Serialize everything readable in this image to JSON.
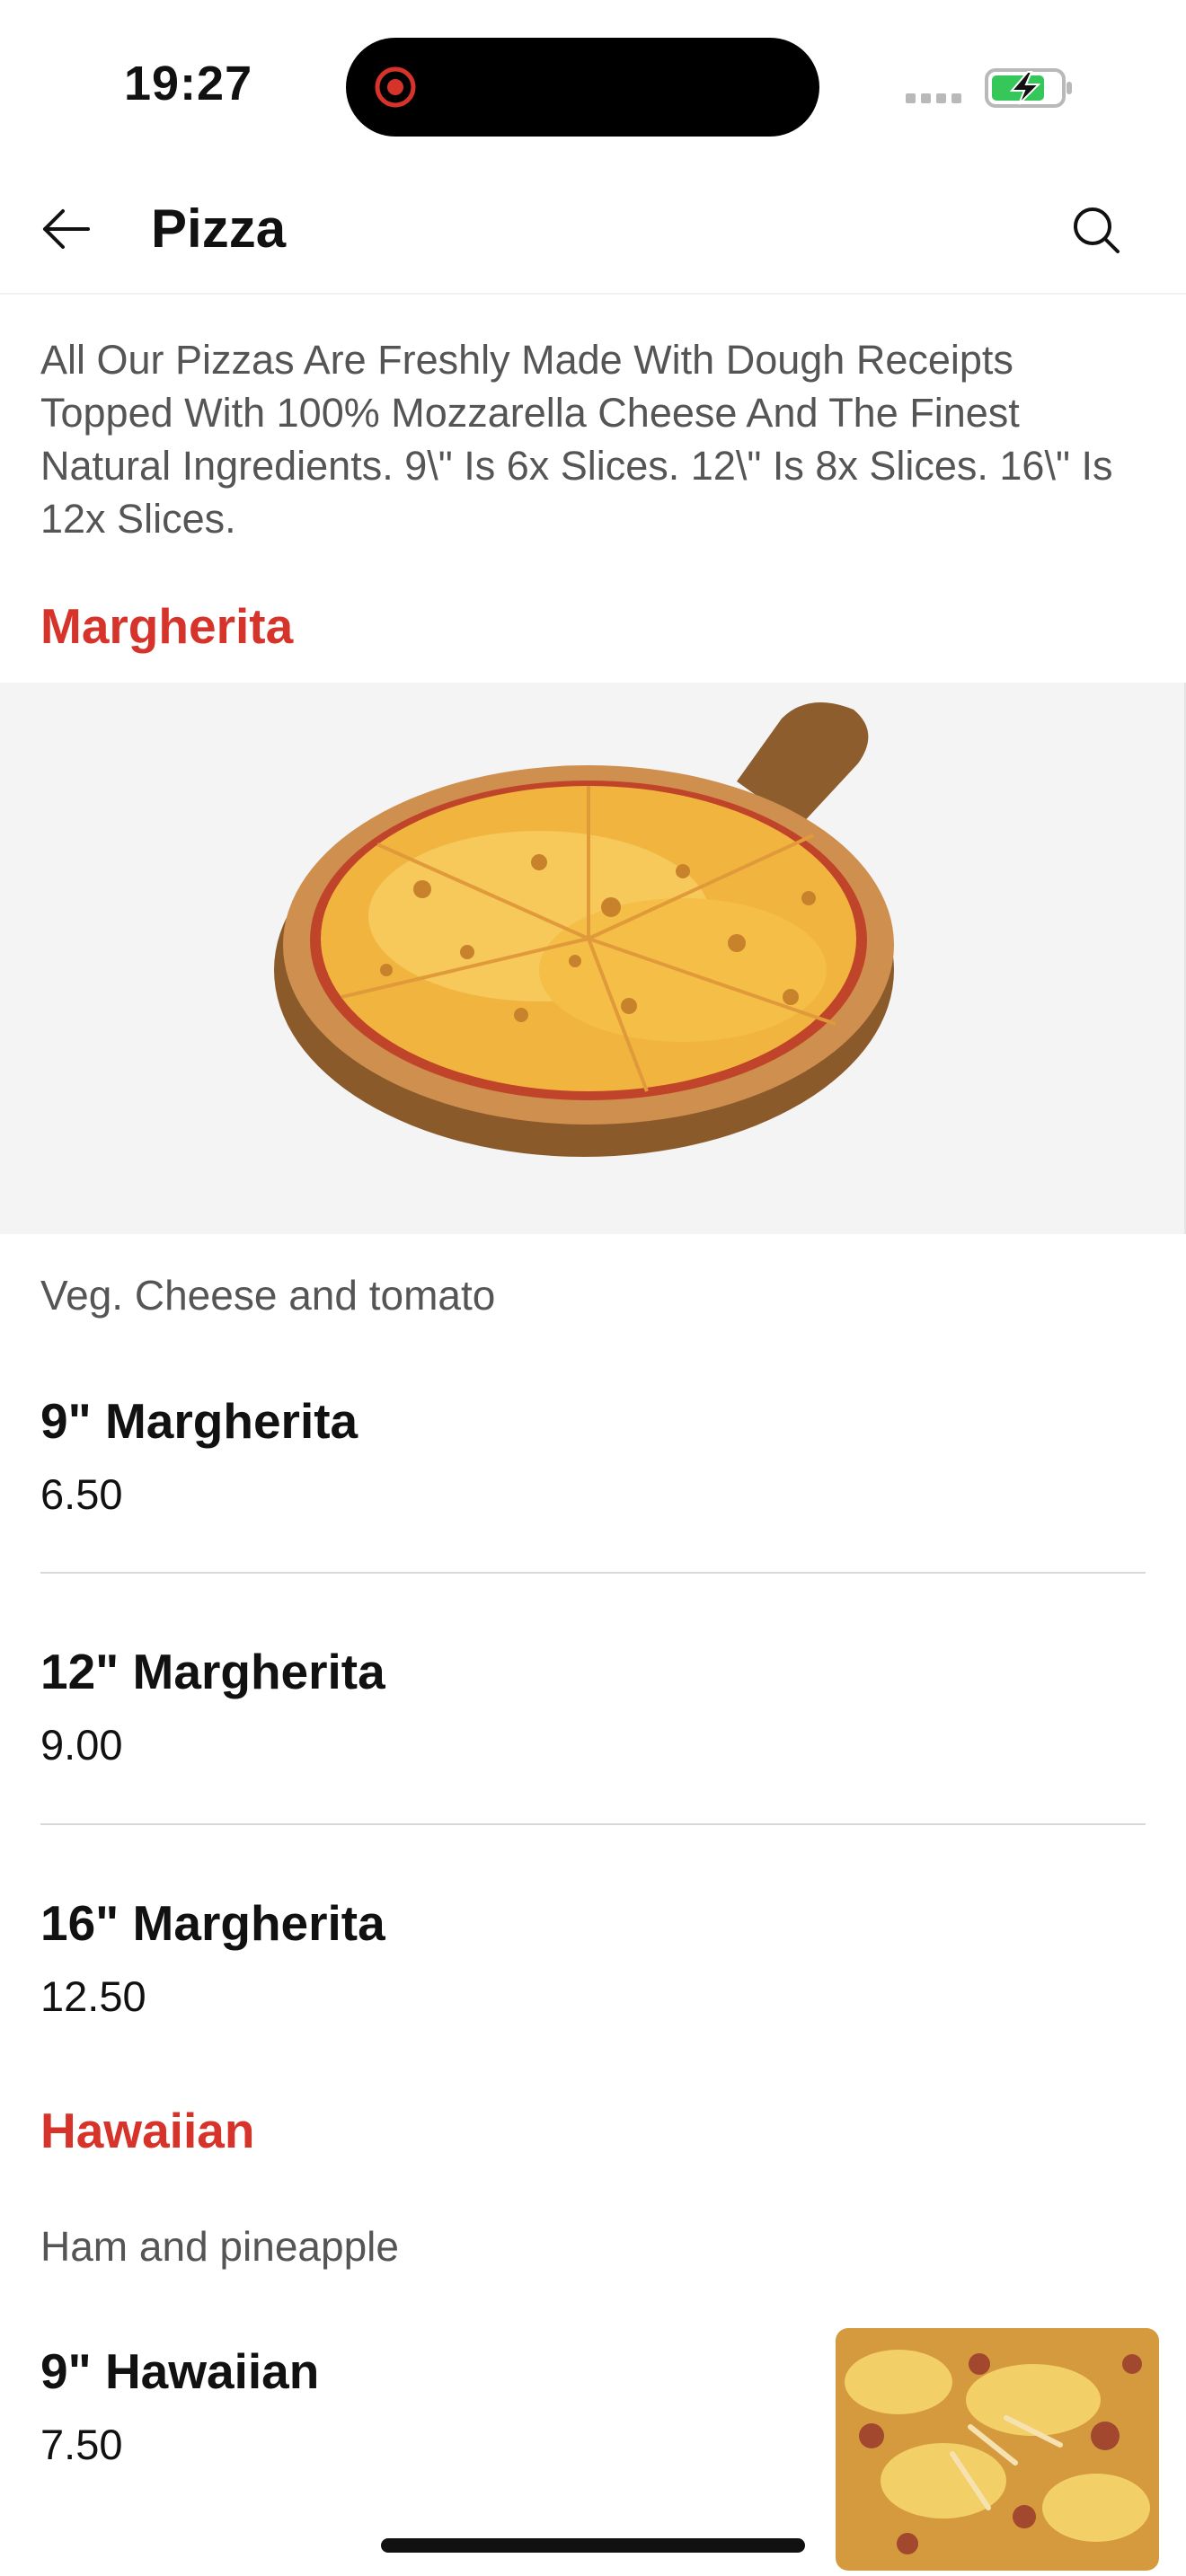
{
  "status_bar": {
    "time": "19:27"
  },
  "header": {
    "title": "Pizza"
  },
  "intro": "All Our Pizzas Are Freshly Made With Dough Receipts Topped With 100% Mozzarella Cheese And The Finest Natural Ingredients. 9\\\" Is 6x Slices. 12\\\" Is 8x Slices. 16\\\" Is 12x Slices.",
  "sections": [
    {
      "title": "Margherita",
      "description": "Veg. Cheese and tomato",
      "items": [
        {
          "name": "9\" Margherita",
          "price": "6.50"
        },
        {
          "name": "12\" Margherita",
          "price": "9.00"
        },
        {
          "name": "16\" Margherita",
          "price": "12.50"
        }
      ]
    },
    {
      "title": "Hawaiian",
      "description": "Ham and pineapple",
      "items": [
        {
          "name": "9\" Hawaiian",
          "price": "7.50"
        }
      ]
    }
  ],
  "colors": {
    "accent": "#d6332b",
    "battery": "#35c759"
  },
  "icons": {
    "back": "arrow-left-icon",
    "search": "search-icon",
    "record": "record-icon"
  }
}
